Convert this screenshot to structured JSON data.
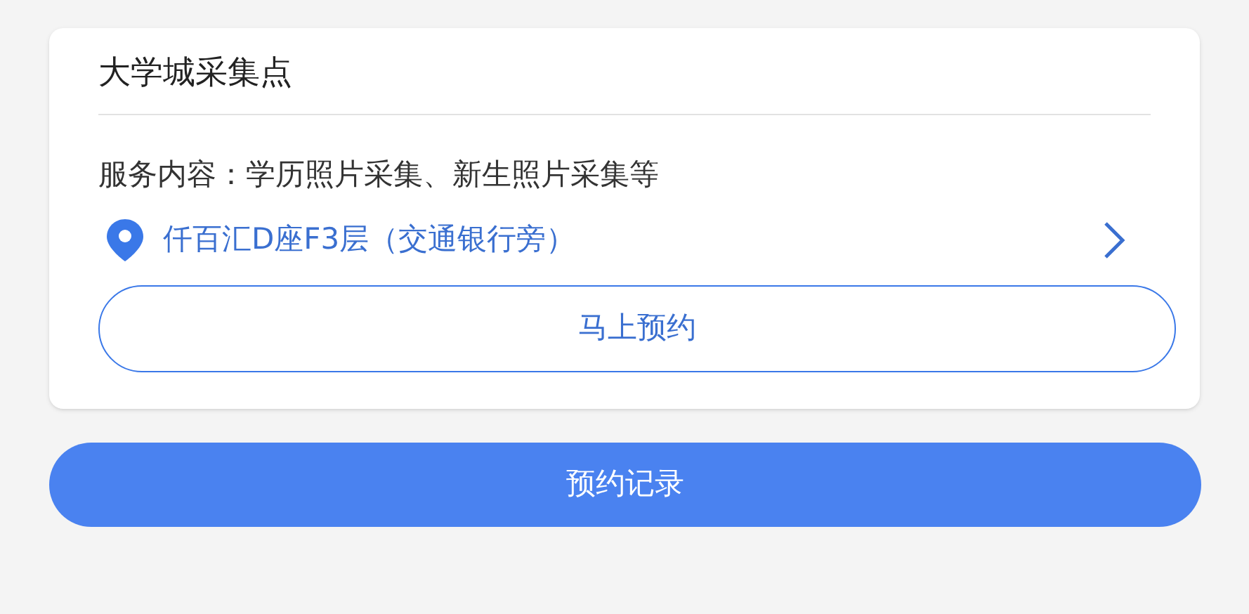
{
  "card": {
    "title": "大学城采集点",
    "service": "服务内容：学历照片采集、新生照片采集等",
    "location": "仟百汇D座F3层（交通银行旁）",
    "book_button": "马上预约"
  },
  "records_button": "预约记录"
}
